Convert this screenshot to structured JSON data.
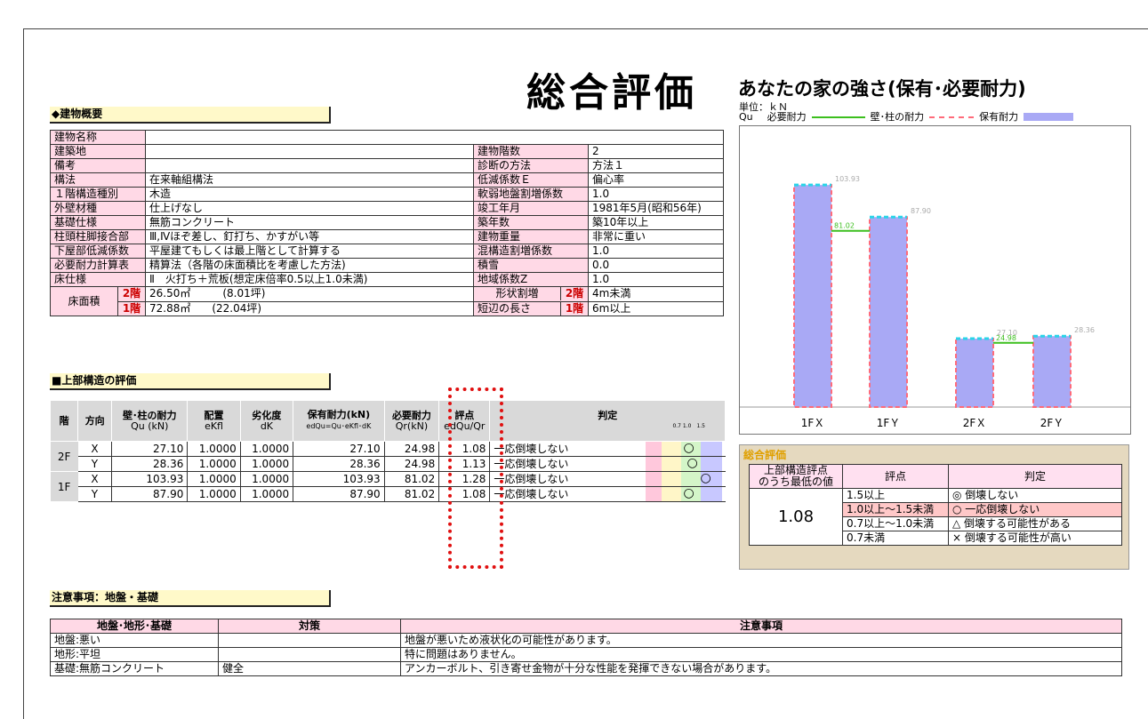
{
  "title": "総合評価",
  "building": {
    "heading": "◆建物概要",
    "rows": [
      {
        "l": "建物名称",
        "v": "",
        "l2": "",
        "v2": ""
      },
      {
        "l": "建築地",
        "v": "",
        "l2": "建物階数",
        "v2": "2"
      },
      {
        "l": "備考",
        "v": "",
        "l2": "診断の方法",
        "v2": "方法１"
      },
      {
        "l": "構法",
        "v": "在来軸組構法",
        "l2": "低減係数Ｅ",
        "v2": "偏心率"
      },
      {
        "l": "１階構造種別",
        "v": "木造",
        "l2": "軟弱地盤割増係数",
        "v2": "1.0"
      },
      {
        "l": "外壁材種",
        "v": "仕上げなし",
        "l2": "竣工年月",
        "v2": "1981年5月(昭和56年)"
      },
      {
        "l": "基礎仕様",
        "v": "無筋コンクリート",
        "l2": "築年数",
        "v2": "築10年以上"
      },
      {
        "l": "柱頭柱脚接合部",
        "v": "Ⅲ,Ⅳほぞ差し、釘打ち、かすがい等",
        "l2": "建物重量",
        "v2": "非常に重い"
      },
      {
        "l": "下屋部低減係数",
        "v": "平屋建てもしくは最上階として計算する",
        "l2": "混構造割増係数",
        "v2": "1.0"
      },
      {
        "l": "必要耐力計算表",
        "v": "精算法（各階の床面積比を考慮した方法)",
        "l2": "積雪",
        "v2": "0.0"
      },
      {
        "l": "床仕様",
        "v": "Ⅱ　火打ち＋荒板(想定床倍率0.5以上1.0未満)",
        "l2": "地域係数Z",
        "v2": "1.0"
      }
    ],
    "floor_area_label": "床面積",
    "floor2_label": "2階",
    "floor1_label": "1階",
    "floor2_area": "26.50㎡　　　(8.01坪)",
    "floor1_area": "72.88㎡　　(22.04坪)",
    "shape_label": "形状割増",
    "short_label": "短辺の長さ",
    "shape_floor2": "2階",
    "shape_floor1": "1階",
    "shape_value": "4m未満",
    "short_value": "6m以上"
  },
  "upper": {
    "heading": "■上部構造の評価",
    "headers": {
      "floor": "階",
      "dir": "方向",
      "wall": "壁･柱の耐力",
      "wall_sub": "Qu (kN)",
      "placement": "配置",
      "placement_sub": "eKfl",
      "deg": "劣化度",
      "deg_sub": "dK",
      "hold": "保有耐力(kN)",
      "hold_sub": "edQu=Qu･eKfl･dK",
      "need": "必要耐力",
      "need_sub": "Qr(kN)",
      "score": "評点",
      "score_sub": "edQu/Qr",
      "judge": "判定",
      "scale_labels": "0.7 1.0　1.5"
    },
    "rows": [
      {
        "floor": "2F",
        "dir": "X",
        "wall": "27.10",
        "placement": "1.0000",
        "deg": "1.0000",
        "hold": "27.10",
        "need": "24.98",
        "score": "1.08",
        "judge": "一応倒壊しない",
        "mark": "○"
      },
      {
        "floor": "",
        "dir": "Y",
        "wall": "28.36",
        "placement": "1.0000",
        "deg": "1.0000",
        "hold": "28.36",
        "need": "24.98",
        "score": "1.13",
        "judge": "一応倒壊しない",
        "mark": "○"
      },
      {
        "floor": "1F",
        "dir": "X",
        "wall": "103.93",
        "placement": "1.0000",
        "deg": "1.0000",
        "hold": "103.93",
        "need": "81.02",
        "score": "1.28",
        "judge": "一応倒壊しない",
        "mark": "○"
      },
      {
        "floor": "",
        "dir": "Y",
        "wall": "87.90",
        "placement": "1.0000",
        "deg": "1.0000",
        "hold": "87.90",
        "need": "81.02",
        "score": "1.08",
        "judge": "一応倒壊しない",
        "mark": "○"
      }
    ]
  },
  "chart_data": {
    "type": "bar",
    "title": "あなたの家の強さ(保有･必要耐力)",
    "unit_line": "単位：ｋＮ",
    "legend": {
      "qu": "Qu",
      "need": "必要耐力",
      "wall": "壁･柱の耐力",
      "hold": "保有耐力"
    },
    "categories": [
      "1FＸ",
      "1FＹ",
      "2FＸ",
      "2FＹ"
    ],
    "series": [
      {
        "name": "保有耐力",
        "values": [
          103.93,
          87.9,
          27.1,
          28.36
        ],
        "labels": [
          "103.93",
          "87.90",
          "27.10",
          "28.36"
        ]
      },
      {
        "name": "必要耐力",
        "values": [
          81.02,
          81.02,
          24.98,
          24.98
        ],
        "labels": [
          "81.02",
          "24.98"
        ]
      }
    ],
    "ylim": [
      0,
      120
    ],
    "colors": {
      "bar": "#a9a9f5",
      "bar_border": "#ff6b7a",
      "bar_top": "#2ad4e8",
      "need": "#3cbf1e"
    }
  },
  "summary": {
    "title": "総合評価",
    "col1": "上部構造評点\nのうち最低の値",
    "col2": "評点",
    "col3": "判定",
    "min_score": "1.08",
    "rows": [
      {
        "range": "1.5以上",
        "judge": "◎ 倒壊しない"
      },
      {
        "range": "1.0以上～1.5未満",
        "judge": "○ 一応倒壊しない"
      },
      {
        "range": "0.7以上～1.0未満",
        "judge": "△ 倒壊する可能性がある"
      },
      {
        "range": "0.7未満",
        "judge": "× 倒壊する可能性が高い"
      }
    ]
  },
  "notes": {
    "heading": "注意事項：地盤・基礎",
    "headers": [
      "地盤･地形･基礎",
      "対策",
      "注意事項"
    ],
    "rows": [
      [
        "地盤:悪い",
        "",
        "地盤が悪いため液状化の可能性があります。"
      ],
      [
        "地形:平坦",
        "",
        "特に問題はありません。"
      ],
      [
        "基礎:無筋コンクリート",
        "健全",
        "アンカーボルト、引き寄せ金物が十分な性能を発揮できない場合があります。"
      ]
    ]
  }
}
